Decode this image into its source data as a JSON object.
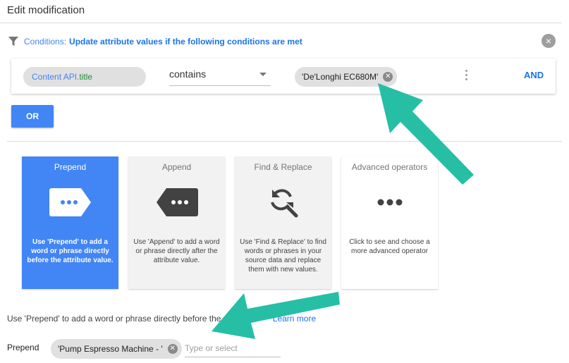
{
  "header": {
    "title": "Edit modification"
  },
  "conditions": {
    "label": "Conditions:",
    "text": "Update attribute values if the following conditions are met",
    "row": {
      "attribute_source": "Content API.",
      "attribute_name": "title",
      "operator": "contains",
      "value": "'De'Longhi EC680M'",
      "and_label": "AND"
    },
    "or_label": "OR"
  },
  "operations": [
    {
      "title": "Prepend",
      "description": "Use 'Prepend' to add a word or phrase directly before the attribute value.",
      "icon": "prepend-tag-icon"
    },
    {
      "title": "Append",
      "description": "Use 'Append' to add a word or phrase directly after the attribute value.",
      "icon": "append-tag-icon"
    },
    {
      "title": "Find & Replace",
      "description": "Use 'Find & Replace' to find words or phrases in your source data and replace them with new values.",
      "icon": "find-replace-icon"
    },
    {
      "title": "Advanced operators",
      "description": "Click to see and choose a more advanced operator",
      "icon": "more-dots-icon"
    }
  ],
  "helper": {
    "text_start": "Use 'Prepend' to add a word or phrase directly before the a",
    "learn_more": "Learn more"
  },
  "prepend_field": {
    "label": "Prepend",
    "chip_value": "'Pump Espresso Machine - '",
    "placeholder": "Type or select"
  },
  "colors": {
    "accent": "#4285f4",
    "arrow": "#26bfa5",
    "link": "#1a73e8"
  }
}
